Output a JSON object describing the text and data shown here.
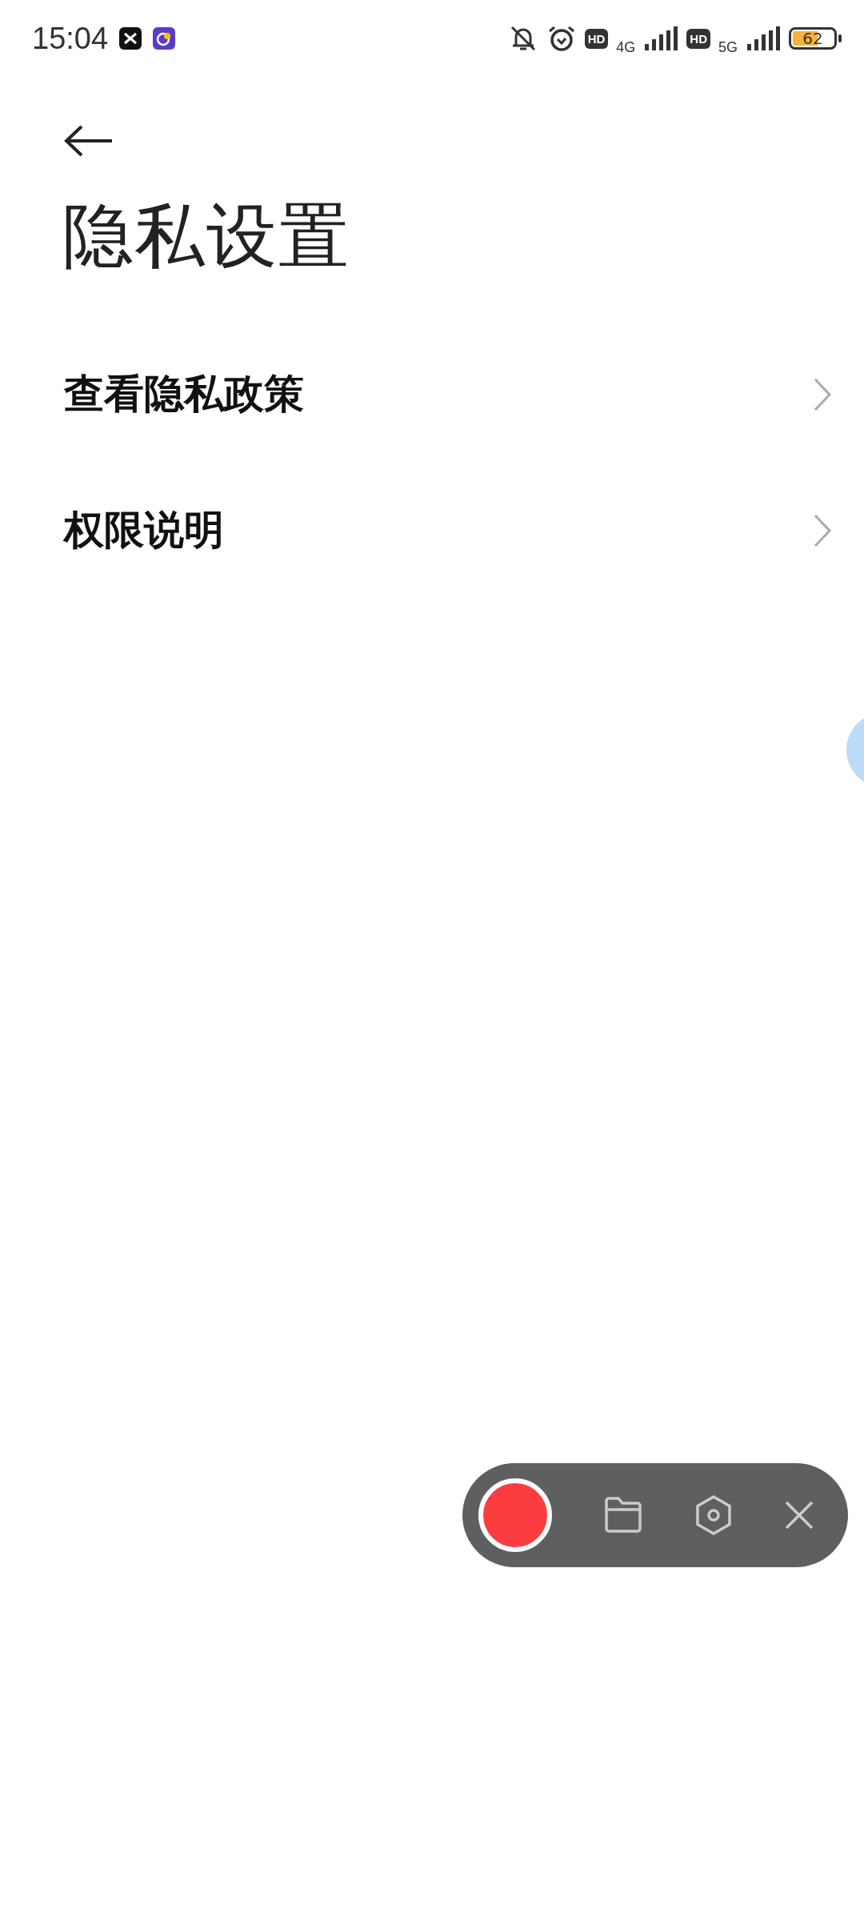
{
  "status_bar": {
    "time": "15:04",
    "signals": [
      {
        "hd": "HD",
        "network": "4G"
      },
      {
        "hd": "HD",
        "network": "5G"
      }
    ],
    "battery": "62"
  },
  "header": {
    "title": "隐私设置"
  },
  "items": [
    {
      "label": "查看隐私政策"
    },
    {
      "label": "权限说明"
    }
  ]
}
